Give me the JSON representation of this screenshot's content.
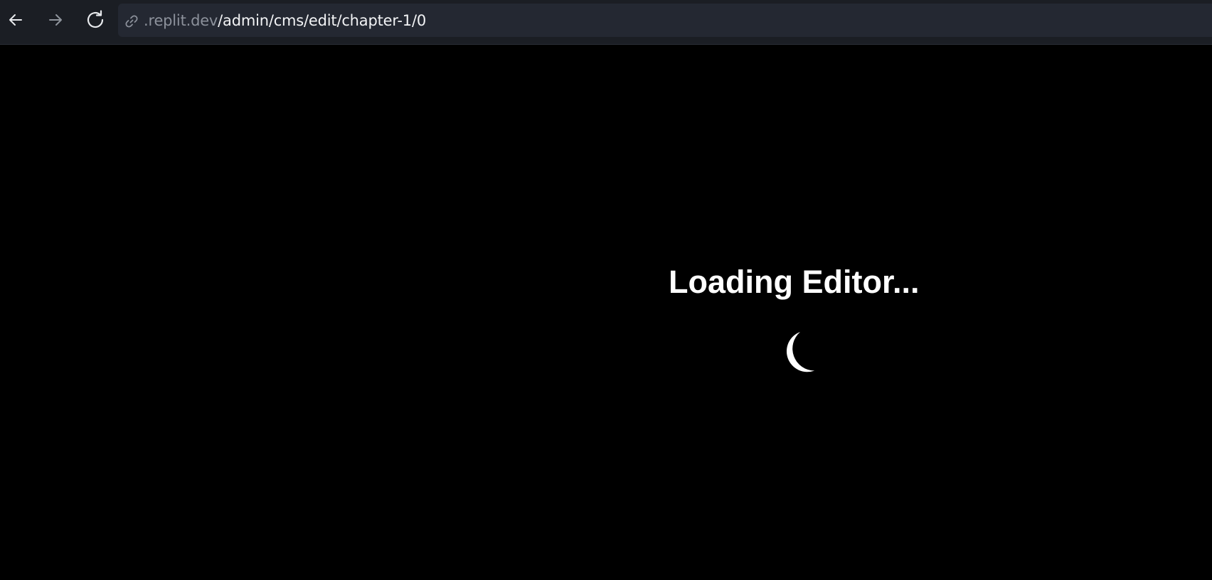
{
  "browser": {
    "url_host": ".replit.dev",
    "url_path": "/admin/cms/edit/chapter-1/0",
    "icons": {
      "back": "arrow-left-icon",
      "forward": "arrow-right-icon",
      "reload": "reload-icon",
      "link": "link-icon"
    }
  },
  "page": {
    "loading_text": "Loading Editor...",
    "spinner": "loading-spinner"
  },
  "colors": {
    "toolbar_bg": "#1b1e24",
    "address_bar_bg": "#242832",
    "page_bg": "#000000",
    "text": "#ffffff",
    "muted_text": "#8c919b"
  }
}
